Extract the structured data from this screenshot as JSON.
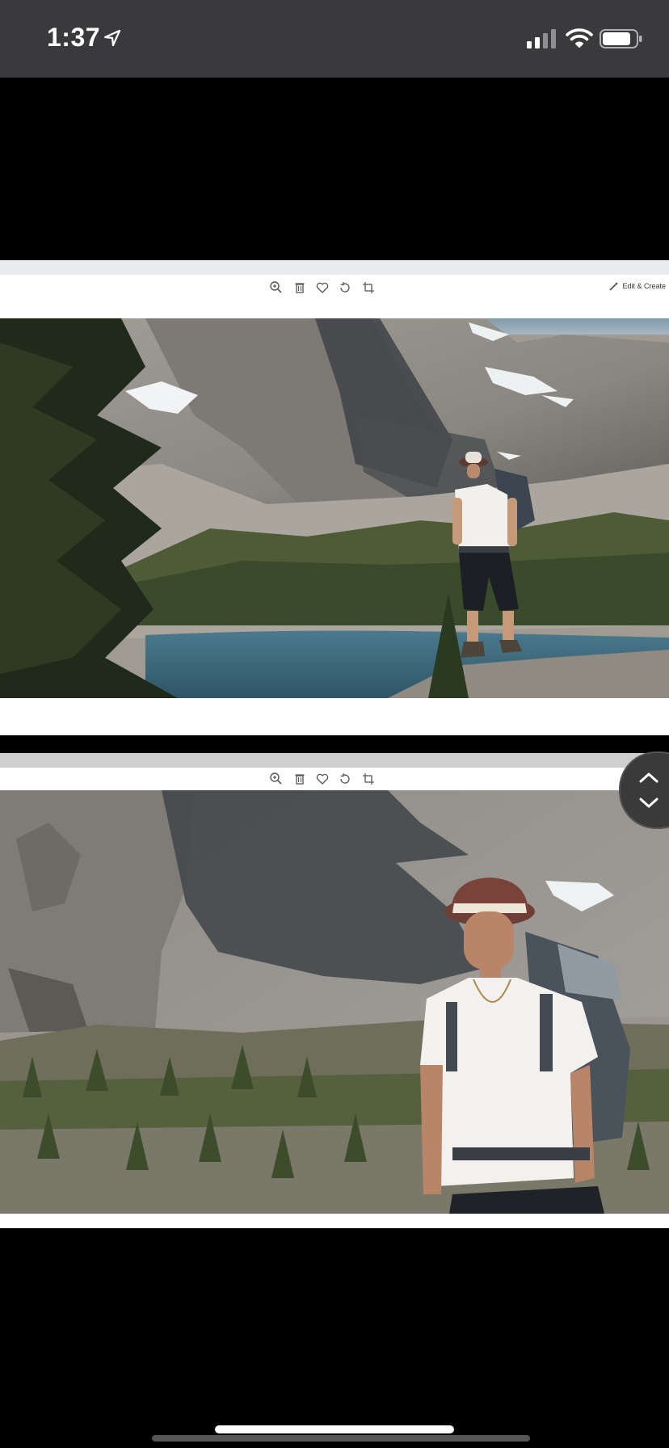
{
  "status_bar": {
    "time": "1:37",
    "icons": [
      "location-arrow-icon",
      "cellular-signal-icon",
      "wifi-icon",
      "battery-icon"
    ]
  },
  "slides": [
    {
      "toolbar": {
        "icons": [
          "zoom-in-icon",
          "delete-icon",
          "favorite-icon",
          "rotate-icon",
          "crop-icon"
        ],
        "edit_create_label": "Edit & Create"
      },
      "photo": "hiker-by-alpine-lake"
    },
    {
      "toolbar": {
        "icons": [
          "zoom-in-icon",
          "delete-icon",
          "favorite-icon",
          "rotate-icon",
          "crop-icon"
        ]
      },
      "photo": "hiker-closeup-mountain"
    }
  ],
  "nav_button": {
    "icons": [
      "chevron-up-icon",
      "chevron-down-icon"
    ]
  },
  "colors": {
    "status_bar_bg": "#3a3a3c",
    "background": "#000000",
    "lake": "#3f6d80",
    "rock": "#9a9690"
  }
}
